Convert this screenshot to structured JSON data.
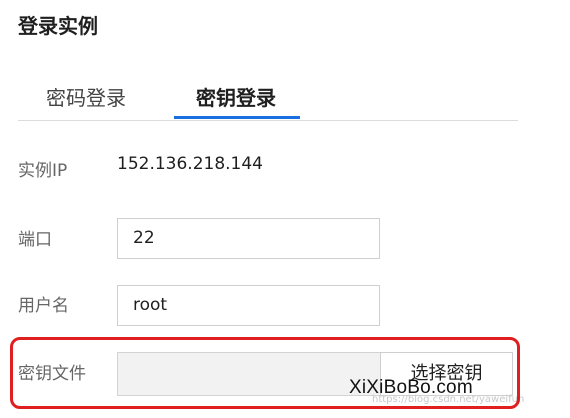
{
  "dialog": {
    "title": "登录实例"
  },
  "tabs": [
    {
      "label": "密码登录",
      "active": false
    },
    {
      "label": "密钥登录",
      "active": true
    }
  ],
  "form": {
    "ip_label": "实例IP",
    "ip_value": "152.136.218.144",
    "port_label": "端口",
    "port_value": "22",
    "username_label": "用户名",
    "username_value": "root",
    "key_file_label": "密钥文件",
    "key_file_value": "",
    "select_key_button": "选择密钥"
  },
  "colors": {
    "accent": "#1a6fe0",
    "highlight": "#e02020",
    "disabled_field": "#f2f2f2"
  },
  "watermark": {
    "faint": "https://blog.csdn.net/yaweifun",
    "logo": "XiXiBoBo.com"
  }
}
